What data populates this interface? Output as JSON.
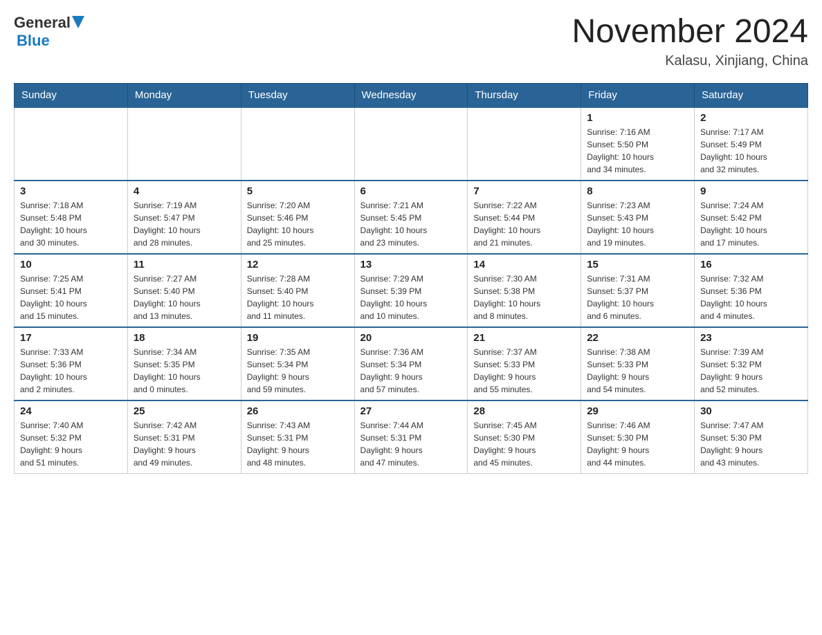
{
  "header": {
    "logo_general": "General",
    "logo_blue": "Blue",
    "month_title": "November 2024",
    "location": "Kalasu, Xinjiang, China"
  },
  "weekdays": [
    "Sunday",
    "Monday",
    "Tuesday",
    "Wednesday",
    "Thursday",
    "Friday",
    "Saturday"
  ],
  "weeks": [
    [
      {
        "day": "",
        "info": ""
      },
      {
        "day": "",
        "info": ""
      },
      {
        "day": "",
        "info": ""
      },
      {
        "day": "",
        "info": ""
      },
      {
        "day": "",
        "info": ""
      },
      {
        "day": "1",
        "info": "Sunrise: 7:16 AM\nSunset: 5:50 PM\nDaylight: 10 hours\nand 34 minutes."
      },
      {
        "day": "2",
        "info": "Sunrise: 7:17 AM\nSunset: 5:49 PM\nDaylight: 10 hours\nand 32 minutes."
      }
    ],
    [
      {
        "day": "3",
        "info": "Sunrise: 7:18 AM\nSunset: 5:48 PM\nDaylight: 10 hours\nand 30 minutes."
      },
      {
        "day": "4",
        "info": "Sunrise: 7:19 AM\nSunset: 5:47 PM\nDaylight: 10 hours\nand 28 minutes."
      },
      {
        "day": "5",
        "info": "Sunrise: 7:20 AM\nSunset: 5:46 PM\nDaylight: 10 hours\nand 25 minutes."
      },
      {
        "day": "6",
        "info": "Sunrise: 7:21 AM\nSunset: 5:45 PM\nDaylight: 10 hours\nand 23 minutes."
      },
      {
        "day": "7",
        "info": "Sunrise: 7:22 AM\nSunset: 5:44 PM\nDaylight: 10 hours\nand 21 minutes."
      },
      {
        "day": "8",
        "info": "Sunrise: 7:23 AM\nSunset: 5:43 PM\nDaylight: 10 hours\nand 19 minutes."
      },
      {
        "day": "9",
        "info": "Sunrise: 7:24 AM\nSunset: 5:42 PM\nDaylight: 10 hours\nand 17 minutes."
      }
    ],
    [
      {
        "day": "10",
        "info": "Sunrise: 7:25 AM\nSunset: 5:41 PM\nDaylight: 10 hours\nand 15 minutes."
      },
      {
        "day": "11",
        "info": "Sunrise: 7:27 AM\nSunset: 5:40 PM\nDaylight: 10 hours\nand 13 minutes."
      },
      {
        "day": "12",
        "info": "Sunrise: 7:28 AM\nSunset: 5:40 PM\nDaylight: 10 hours\nand 11 minutes."
      },
      {
        "day": "13",
        "info": "Sunrise: 7:29 AM\nSunset: 5:39 PM\nDaylight: 10 hours\nand 10 minutes."
      },
      {
        "day": "14",
        "info": "Sunrise: 7:30 AM\nSunset: 5:38 PM\nDaylight: 10 hours\nand 8 minutes."
      },
      {
        "day": "15",
        "info": "Sunrise: 7:31 AM\nSunset: 5:37 PM\nDaylight: 10 hours\nand 6 minutes."
      },
      {
        "day": "16",
        "info": "Sunrise: 7:32 AM\nSunset: 5:36 PM\nDaylight: 10 hours\nand 4 minutes."
      }
    ],
    [
      {
        "day": "17",
        "info": "Sunrise: 7:33 AM\nSunset: 5:36 PM\nDaylight: 10 hours\nand 2 minutes."
      },
      {
        "day": "18",
        "info": "Sunrise: 7:34 AM\nSunset: 5:35 PM\nDaylight: 10 hours\nand 0 minutes."
      },
      {
        "day": "19",
        "info": "Sunrise: 7:35 AM\nSunset: 5:34 PM\nDaylight: 9 hours\nand 59 minutes."
      },
      {
        "day": "20",
        "info": "Sunrise: 7:36 AM\nSunset: 5:34 PM\nDaylight: 9 hours\nand 57 minutes."
      },
      {
        "day": "21",
        "info": "Sunrise: 7:37 AM\nSunset: 5:33 PM\nDaylight: 9 hours\nand 55 minutes."
      },
      {
        "day": "22",
        "info": "Sunrise: 7:38 AM\nSunset: 5:33 PM\nDaylight: 9 hours\nand 54 minutes."
      },
      {
        "day": "23",
        "info": "Sunrise: 7:39 AM\nSunset: 5:32 PM\nDaylight: 9 hours\nand 52 minutes."
      }
    ],
    [
      {
        "day": "24",
        "info": "Sunrise: 7:40 AM\nSunset: 5:32 PM\nDaylight: 9 hours\nand 51 minutes."
      },
      {
        "day": "25",
        "info": "Sunrise: 7:42 AM\nSunset: 5:31 PM\nDaylight: 9 hours\nand 49 minutes."
      },
      {
        "day": "26",
        "info": "Sunrise: 7:43 AM\nSunset: 5:31 PM\nDaylight: 9 hours\nand 48 minutes."
      },
      {
        "day": "27",
        "info": "Sunrise: 7:44 AM\nSunset: 5:31 PM\nDaylight: 9 hours\nand 47 minutes."
      },
      {
        "day": "28",
        "info": "Sunrise: 7:45 AM\nSunset: 5:30 PM\nDaylight: 9 hours\nand 45 minutes."
      },
      {
        "day": "29",
        "info": "Sunrise: 7:46 AM\nSunset: 5:30 PM\nDaylight: 9 hours\nand 44 minutes."
      },
      {
        "day": "30",
        "info": "Sunrise: 7:47 AM\nSunset: 5:30 PM\nDaylight: 9 hours\nand 43 minutes."
      }
    ]
  ]
}
